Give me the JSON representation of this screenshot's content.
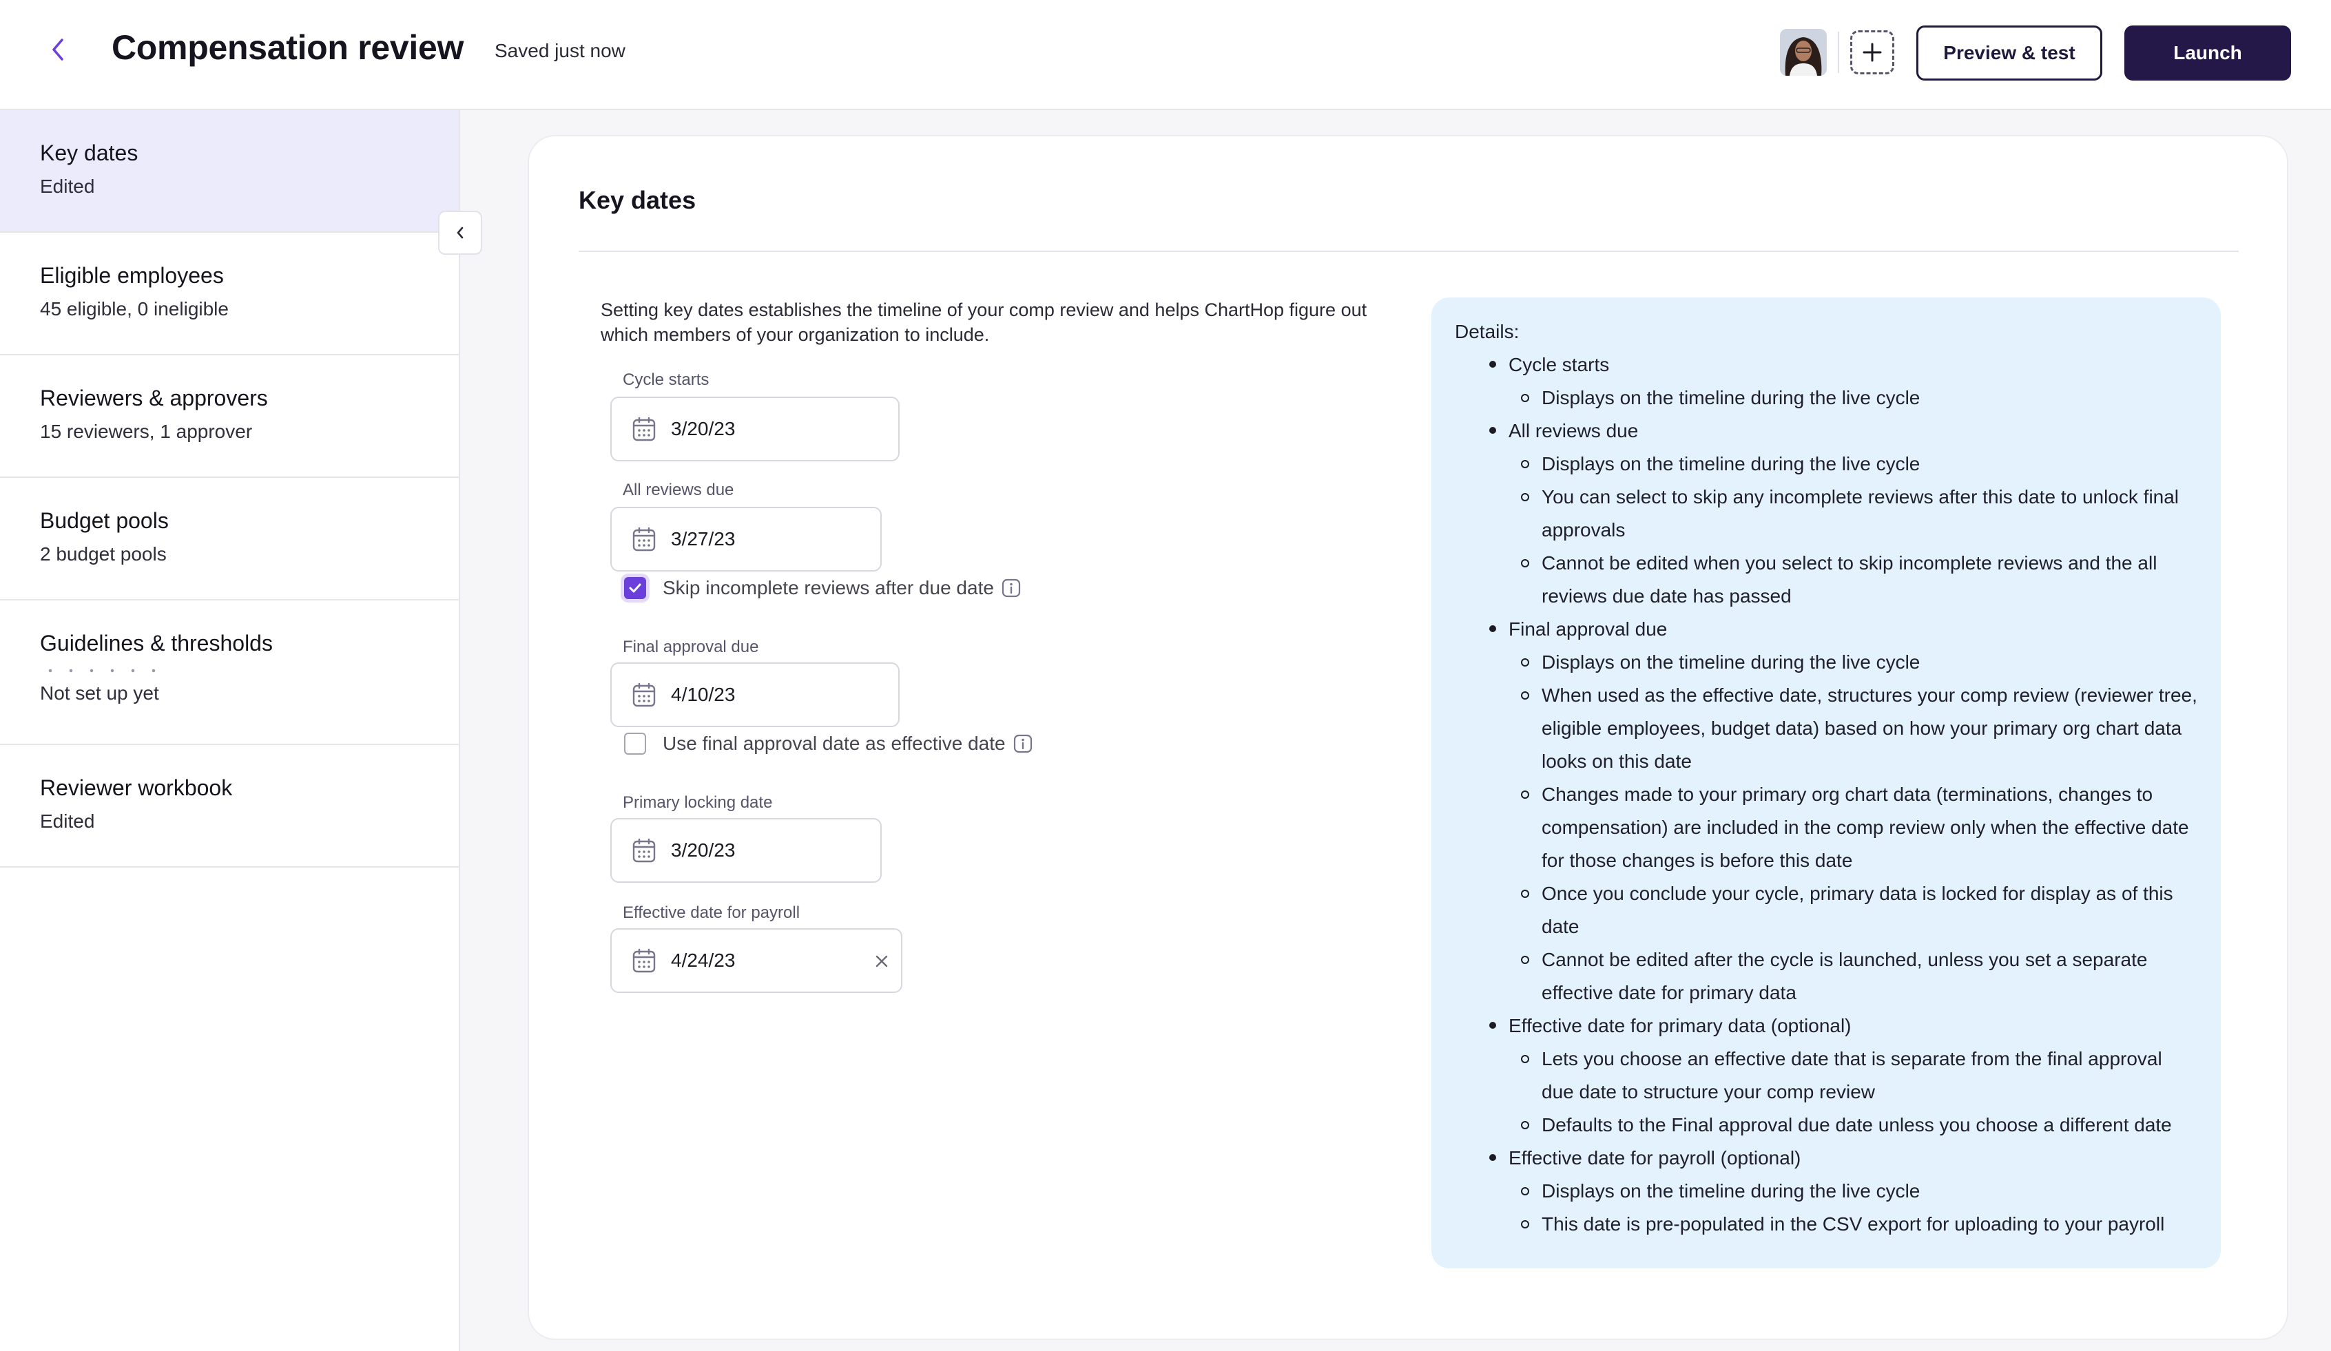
{
  "header": {
    "title": "Compensation review",
    "status": "Saved just now",
    "preview_label": "Preview & test",
    "launch_label": "Launch"
  },
  "sidebar": {
    "items": [
      {
        "title": "Key dates",
        "subtitle": "Edited"
      },
      {
        "title": "Eligible employees",
        "subtitle": "45 eligible, 0 ineligible"
      },
      {
        "title": "Reviewers & approvers",
        "subtitle": "15 reviewers, 1 approver"
      },
      {
        "title": "Budget pools",
        "subtitle": "2 budget pools"
      },
      {
        "title": "Guidelines & thresholds",
        "subtitle": "Not set up yet"
      },
      {
        "title": "Reviewer workbook",
        "subtitle": "Edited"
      }
    ]
  },
  "main": {
    "title": "Key dates",
    "intro": "Setting key dates establishes the timeline of your comp review and helps ChartHop figure out which members of your organization to include.",
    "fields": {
      "cycle_starts": {
        "label": "Cycle starts",
        "value": "3/20/23"
      },
      "all_reviews_due": {
        "label": "All reviews due",
        "value": "3/27/23"
      },
      "final_approval_due": {
        "label": "Final approval due",
        "value": "4/10/23"
      },
      "primary_locking_date": {
        "label": "Primary locking date",
        "value": "3/20/23"
      },
      "effective_payroll": {
        "label": "Effective date for payroll",
        "value": "4/24/23"
      }
    },
    "skip_incomplete": {
      "label": "Skip incomplete reviews after due date",
      "checked": true
    },
    "use_final_approval": {
      "label": "Use final approval date as effective date",
      "checked": false
    }
  },
  "details": {
    "heading": "Details:",
    "sections": [
      {
        "title": "Cycle starts",
        "items": [
          "Displays on the timeline during the live cycle"
        ]
      },
      {
        "title": "All reviews due",
        "items": [
          "Displays on the timeline during the live cycle",
          "You can select to skip any incomplete reviews after this date to unlock final approvals",
          "Cannot be edited when you select to skip incomplete reviews and the all reviews due date has passed"
        ]
      },
      {
        "title": "Final approval due",
        "items": [
          "Displays on the timeline during the live cycle",
          "When used as the effective date, structures your comp review (reviewer tree, eligible employees, budget data) based on how your primary org chart data looks on this date",
          "Changes made to your primary org chart data (terminations, changes to compensation) are included in the comp review only when the effective date for those changes is before this date",
          "Once you conclude your cycle, primary data is locked for display as of this date",
          "Cannot be edited after the cycle is launched, unless you set a separate effective date for primary data"
        ]
      },
      {
        "title": "Effective date for primary data (optional)",
        "items": [
          "Lets you choose an effective date that is separate from the final approval due date to structure your comp review",
          "Defaults to the Final approval due date unless you choose a different date"
        ]
      },
      {
        "title": "Effective date for payroll (optional)",
        "items": [
          "Displays on the timeline during the live cycle",
          "This date is pre-populated in the CSV export for uploading to your payroll"
        ]
      }
    ]
  },
  "colors": {
    "accent": "#6b3fd9",
    "primary_button": "#231847",
    "active_nav": "#ecebfb",
    "details_bg": "#e4f2fd"
  },
  "icons": [
    "chevron-left-icon",
    "plus-icon",
    "calendar-icon",
    "info-icon",
    "close-icon",
    "checkmark-icon"
  ]
}
